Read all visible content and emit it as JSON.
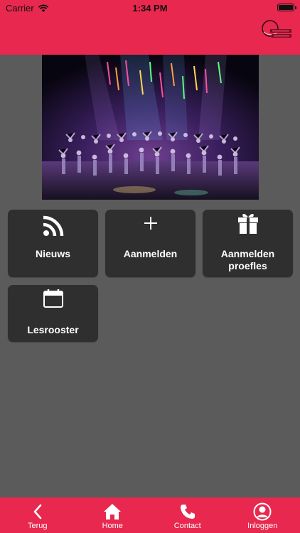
{
  "status": {
    "carrier": "Carrier",
    "time": "1:34 PM"
  },
  "tiles": [
    {
      "label": "Nieuws",
      "icon": "rss-icon"
    },
    {
      "label": "Aanmelden",
      "icon": "plus-icon"
    },
    {
      "label": "Aanmelden proefles",
      "icon": "gift-icon"
    },
    {
      "label": "Lesrooster",
      "icon": "calendar-icon"
    }
  ],
  "tabs": [
    {
      "label": "Terug",
      "icon": "back-icon"
    },
    {
      "label": "Home",
      "icon": "home-icon"
    },
    {
      "label": "Contact",
      "icon": "phone-icon"
    },
    {
      "label": "Inloggen",
      "icon": "user-icon"
    }
  ],
  "colors": {
    "brand": "#e8284e",
    "background": "#5b5b5b",
    "tile": "#2f2f2f"
  }
}
